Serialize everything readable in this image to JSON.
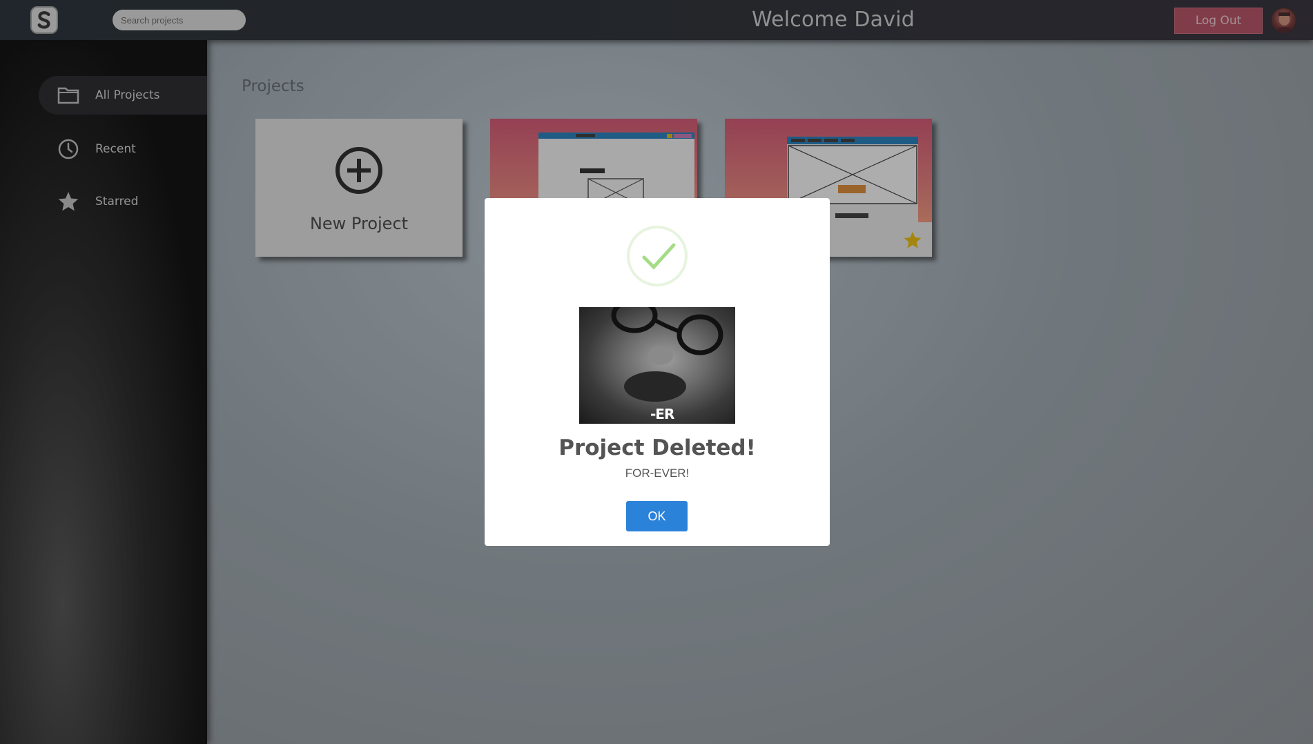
{
  "header": {
    "search_placeholder": "Search projects",
    "welcome_text": "Welcome David",
    "logout_label": "Log Out"
  },
  "sidebar": {
    "items": [
      {
        "label": "All Projects",
        "icon": "folder-icon",
        "active": true
      },
      {
        "label": "Recent",
        "icon": "clock-icon",
        "active": false
      },
      {
        "label": "Starred",
        "icon": "star-icon",
        "active": false
      }
    ]
  },
  "main": {
    "title": "Projects",
    "new_project_label": "New Project",
    "projects": [
      {
        "starred": false
      },
      {
        "starred": true
      }
    ]
  },
  "modal": {
    "icon": "success-check-icon",
    "image_caption": "-ER",
    "title": "Project Deleted!",
    "text": "FOR-EVER!",
    "ok_label": "OK"
  },
  "colors": {
    "logout_bg": "#b04759",
    "ok_button": "#2b82d9",
    "star": "#e6b800",
    "check": "#a5dc86"
  }
}
